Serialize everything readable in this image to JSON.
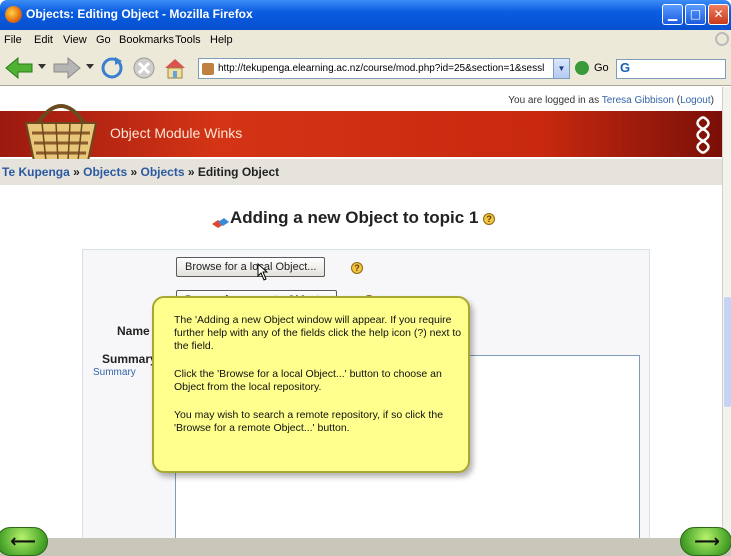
{
  "window": {
    "title": "Objects: Editing Object - Mozilla Firefox",
    "minimize_glyph": "▁",
    "maximize_glyph": "□",
    "close_glyph": "✕"
  },
  "menu": [
    "File",
    "Edit",
    "View",
    "Go",
    "Bookmarks",
    "Tools",
    "Help"
  ],
  "toolbar": {
    "url": "http://tekupenga.elearning.ac.nz/course/mod.php?id=25&section=1&sessl",
    "go_label": "Go",
    "search_value": "G"
  },
  "page": {
    "login_prefix": "You are logged in as ",
    "user_name": "Teresa Gibbison",
    "logout_open": " (",
    "logout_label": "Logout",
    "logout_close": ")",
    "banner_title": "Object Module Winks",
    "breadcrumb": {
      "item1": "Te Kupenga",
      "sep": " » ",
      "item2": "Objects",
      "item3": "Objects",
      "current": "Editing Object"
    },
    "heading": "Adding a new Object to topic 1",
    "help_glyph": "?",
    "browse_local_label": "Browse for a local Object...",
    "browse_remote_label": "Browse for a remote Object...",
    "name_label": "Name",
    "summary_label": "Summary",
    "summary_link": "Summary"
  },
  "callout": {
    "p1": "The 'Adding a new Object window will appear.  If you require further help with any of the fields click the help icon (?) next to the field.",
    "p2": "Click the 'Browse for a local Object...' button to choose an Object from the local repository.",
    "p3": "You may wish to search a remote repository, if so click the 'Browse for a remote Object...' button."
  },
  "nav": {
    "back_glyph": "⟵",
    "forward_glyph": "⟶"
  },
  "colors": {
    "banner_red": "#c8290f",
    "callout_yellow": "#ffff8e",
    "link_blue": "#2c5aa0"
  }
}
